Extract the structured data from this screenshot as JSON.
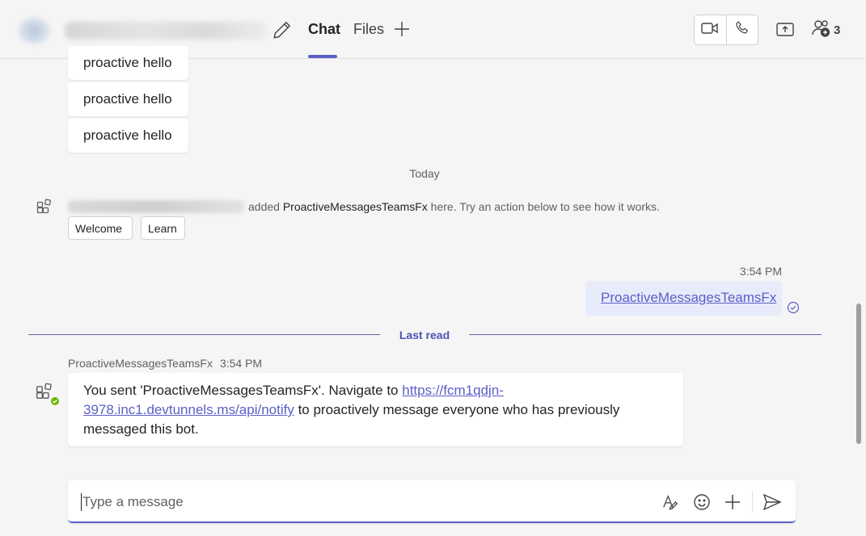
{
  "header": {
    "tabs": [
      {
        "label": "Chat",
        "active": true
      },
      {
        "label": "Files",
        "active": false
      }
    ],
    "participants_count": "3"
  },
  "messages": {
    "earlier": [
      "proactive hello",
      "proactive hello",
      "proactive hello"
    ],
    "date_divider": "Today",
    "system": {
      "text_added": "added",
      "app_name": "ProactiveMessagesTeamsFx",
      "text_rest": "here. Try an action below to see how it works.",
      "actions": [
        "Welcome",
        "Learn"
      ]
    },
    "sent": {
      "time": "3:54 PM",
      "text": "ProactiveMessagesTeamsFx"
    },
    "last_read": "Last read",
    "bot": {
      "sender": "ProactiveMessagesTeamsFx",
      "time": "3:54 PM",
      "text_before": "You sent 'ProactiveMessagesTeamsFx'. Navigate to",
      "link_part1": "https://fcm1qdjn-",
      "link_part2": "3978.inc1.devtunnels.ms/api/notify",
      "text_after": "to proactively message everyone who has previously messaged this bot."
    }
  },
  "compose": {
    "placeholder": "Type a message"
  },
  "colors": {
    "accent": "#5b5fc7",
    "sent_bubble": "#e8ebfa",
    "status_available": "#6bb700"
  }
}
